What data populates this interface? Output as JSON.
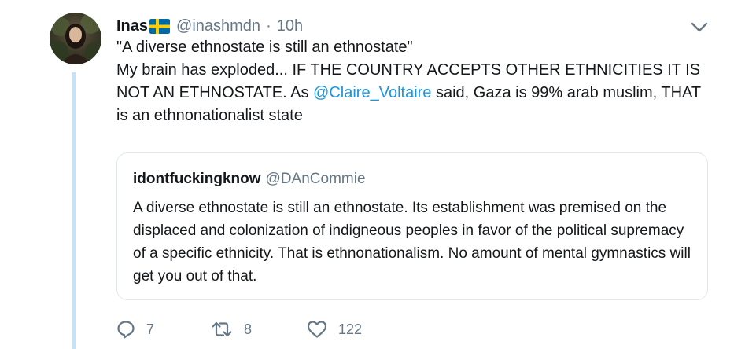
{
  "tweet": {
    "author": {
      "display_name": "Inas",
      "handle": "@inashmdn",
      "flag": "swedish-flag-icon",
      "avatar": "avatar"
    },
    "separator": "·",
    "timestamp": "10h",
    "text": {
      "line1": "\"A diverse ethnostate is still an ethnostate\"",
      "body_before_mention": "My brain has exploded... IF THE COUNTRY ACCEPTS OTHER ETHNICITIES IT IS NOT AN ETHNOSTATE. As ",
      "mention": "@Claire_Voltaire",
      "body_after_mention": " said, Gaza is 99% arab muslim, THAT is an ethnonationalist state"
    },
    "quoted": {
      "display_name": "idontfuckingknow",
      "handle": "@DAnCommie",
      "text": "A diverse ethnostate is still an ethnostate. Its establishment was premised on the displaced and colonization of indigneous peoples in favor of the political supremacy of a specific ethnicity. That is ethnonationalism. No amount of mental gymnastics will get you out of that."
    },
    "actions": {
      "replies": "7",
      "retweets": "8",
      "likes": "122"
    }
  },
  "colors": {
    "link": "#1b95e0",
    "muted": "#657786",
    "thread_line": "#c4e3f8",
    "border": "#e1e8ed"
  }
}
